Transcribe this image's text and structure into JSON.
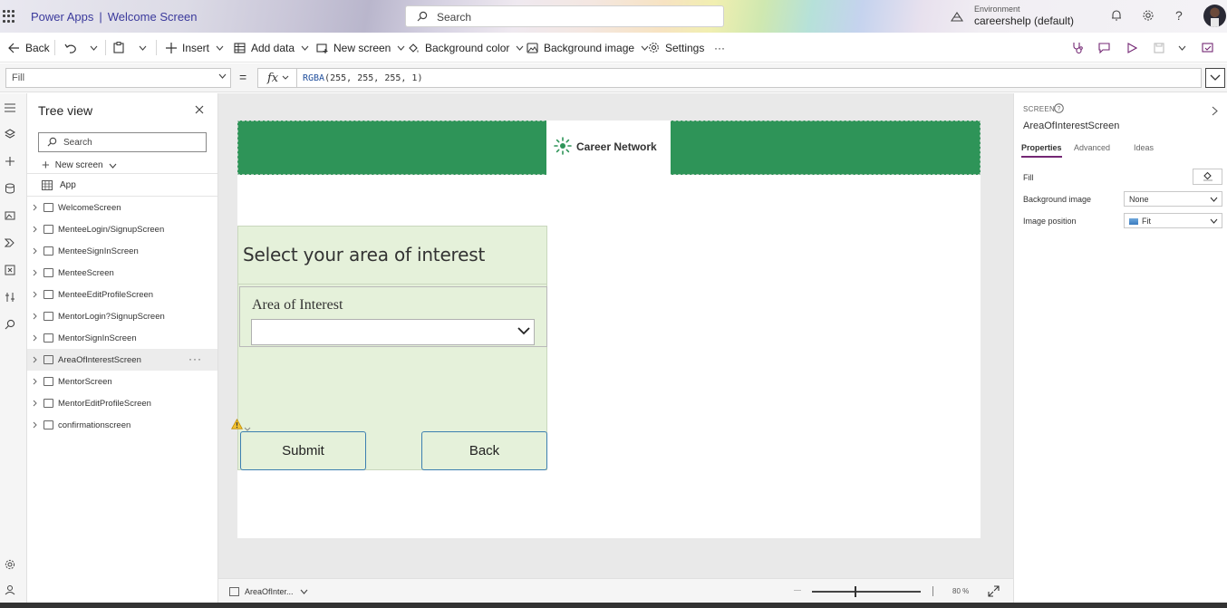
{
  "header": {
    "app_name": "Power Apps",
    "separator": "|",
    "screen_name": "Welcome Screen",
    "search_placeholder": "Search",
    "environment_label": "Environment",
    "environment_value": "careershelp (default)"
  },
  "commandbar": {
    "back": "Back",
    "insert": "Insert",
    "add_data": "Add data",
    "new_screen": "New screen",
    "background_color": "Background color",
    "background_image": "Background image",
    "settings": "Settings",
    "more": "···"
  },
  "formulabar": {
    "property": "Fill",
    "equals": "=",
    "fx": "fx",
    "formula_fn": "RGBA",
    "formula_args": "(255, 255, 255, 1)"
  },
  "treeview": {
    "title": "Tree view",
    "search_placeholder": "Search",
    "new_screen": "New screen",
    "app": "App",
    "screens": [
      {
        "name": "WelcomeScreen"
      },
      {
        "name": "MenteeLogin/SignupScreen"
      },
      {
        "name": "MenteeSignInScreen"
      },
      {
        "name": "MenteeScreen"
      },
      {
        "name": "MenteeEditProfileScreen"
      },
      {
        "name": "MentorLogin?SignupScreen"
      },
      {
        "name": "MentorSignInScreen"
      },
      {
        "name": "AreaOfInterestScreen",
        "selected": true
      },
      {
        "name": "MentorScreen"
      },
      {
        "name": "MentorEditProfileScreen"
      },
      {
        "name": "confirmationscreen"
      }
    ]
  },
  "canvas": {
    "logo_text": "Career Network",
    "panel_title": "Select your area of interest",
    "card_label": "Area of Interest",
    "submit": "Submit",
    "back": "Back",
    "header_color": "#2e9458",
    "panel_color": "#e5f1da"
  },
  "properties": {
    "kind": "SCREEN",
    "name": "AreaOfInterestScreen",
    "tabs": [
      "Properties",
      "Advanced",
      "Ideas"
    ],
    "fill_label": "Fill",
    "bg_image_label": "Background image",
    "bg_image_value": "None",
    "image_position_label": "Image position",
    "image_position_value": "Fit"
  },
  "bottombar": {
    "screen": "AreaOfInter...",
    "zoom": "80  %"
  }
}
